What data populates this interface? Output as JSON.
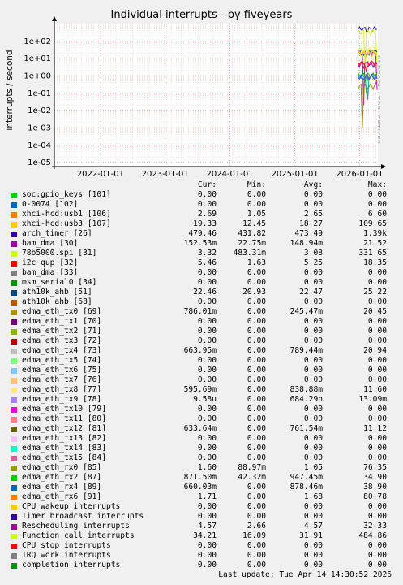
{
  "chart_data": {
    "type": "line",
    "title": "Individual interrupts - by fiveyears",
    "ylabel": "interrupts / second",
    "side_label": "RRDTOOL / TOBI OETIKER",
    "y_scale": "log",
    "y_ticks": [
      "1e-05",
      "1e-04",
      "1e-03",
      "1e-02",
      "1e-01",
      "1e+00",
      "1e+01",
      "1e+02"
    ],
    "x_ticks": [
      "2022-01-01",
      "2023-01-01",
      "2024-01-01",
      "2025-01-01",
      "2026-01-01"
    ],
    "grid": true,
    "data_start": "2025-12-25",
    "x_range": [
      "2021-04-16",
      "2026-04-14"
    ],
    "series": [
      {
        "name": "arch_timer [26]",
        "color": "#1b1bb4",
        "values": [
          431.82,
          479.46,
          473.49
        ]
      },
      {
        "name": "bam_dma [30]",
        "color": "#c800c8",
        "values": [
          0.02,
          0.15,
          21.52
        ]
      },
      {
        "name": "78b5000.spi [31]",
        "color": "#d8f022",
        "values": [
          3.32,
          3.08,
          331.65
        ]
      },
      {
        "name": "i2c_qup [32]",
        "color": "#f01b1b",
        "values": [
          1.63,
          5.46,
          5.25
        ]
      },
      {
        "name": "ath10k_ahb [51]",
        "color": "#0f5f6e",
        "values": [
          20.93,
          22.46,
          22.47
        ]
      },
      {
        "name": "edma_eth_tx0 [69]",
        "color": "#a08000",
        "values": [
          0.001,
          0.786,
          0.245
        ]
      },
      {
        "name": "edma_eth_tx4 [73]",
        "color": "#a0a0a0",
        "values": [
          0.6,
          0.66,
          0.79
        ]
      },
      {
        "name": "edma_eth_tx8 [77]",
        "color": "#fff080",
        "values": [
          0.6,
          0.6,
          0.84
        ]
      },
      {
        "name": "edma_eth_rx0 [85]",
        "color": "#33a02c",
        "values": [
          0.09,
          1.6,
          1.05
        ]
      },
      {
        "name": "edma_eth_rx2 [87]",
        "color": "#27a0a0",
        "values": [
          0.04,
          0.87,
          0.95
        ]
      },
      {
        "name": "edma_eth_rx4 [89]",
        "color": "#3060d0",
        "values": [
          0.66,
          0.66,
          0.88
        ]
      },
      {
        "name": "Rescheduling interrupts",
        "color": "#b000a0",
        "values": [
          2.66,
          4.57,
          4.57
        ]
      },
      {
        "name": "Function call interrupts",
        "color": "#f0f040",
        "values": [
          16.09,
          34.21,
          31.91
        ]
      },
      {
        "name": "xhci-hcd:usb3 [107]",
        "color": "#f0c000",
        "values": [
          12.45,
          19.33,
          18.27
        ]
      }
    ],
    "legend_columns": [
      "Cur:",
      "Min:",
      "Avg:",
      "Max:"
    ],
    "legend": [
      {
        "name": "soc:gpio_keys [101]",
        "color": "#00cc00",
        "cur": "0.00",
        "min": "0.00",
        "avg": "0.00",
        "max": "0.00"
      },
      {
        "name": "0-0074 [102]",
        "color": "#0066b3",
        "cur": "0.00",
        "min": "0.00",
        "avg": "0.00",
        "max": "0.00"
      },
      {
        "name": "xhci-hcd:usb1 [106]",
        "color": "#ff8000",
        "cur": "2.69",
        "min": "1.05",
        "avg": "2.65",
        "max": "6.60"
      },
      {
        "name": "xhci-hcd:usb3 [107]",
        "color": "#ffcc00",
        "cur": "19.33",
        "min": "12.45",
        "avg": "18.27",
        "max": "109.65"
      },
      {
        "name": "arch_timer [26]",
        "color": "#330099",
        "cur": "479.46",
        "min": "431.82",
        "avg": "473.49",
        "max": "1.39k"
      },
      {
        "name": "bam_dma [30]",
        "color": "#990099",
        "cur": "152.53m",
        "min": "22.75m",
        "avg": "148.94m",
        "max": "21.52"
      },
      {
        "name": "78b5000.spi [31]",
        "color": "#ccff00",
        "cur": "3.32",
        "min": "483.31m",
        "avg": "3.08",
        "max": "331.65"
      },
      {
        "name": "i2c_qup [32]",
        "color": "#ff0000",
        "cur": "5.46",
        "min": "1.63",
        "avg": "5.25",
        "max": "18.35"
      },
      {
        "name": "bam_dma [33]",
        "color": "#808080",
        "cur": "0.00",
        "min": "0.00",
        "avg": "0.00",
        "max": "0.00"
      },
      {
        "name": "msm_serial0 [34]",
        "color": "#008f00",
        "cur": "0.00",
        "min": "0.00",
        "avg": "0.00",
        "max": "0.00"
      },
      {
        "name": "ath10k_ahb [51]",
        "color": "#00487d",
        "cur": "22.46",
        "min": "20.93",
        "avg": "22.47",
        "max": "25.22"
      },
      {
        "name": "ath10k_ahb [68]",
        "color": "#b35a00",
        "cur": "0.00",
        "min": "0.00",
        "avg": "0.00",
        "max": "0.00"
      },
      {
        "name": "edma_eth_tx0 [69]",
        "color": "#b38f00",
        "cur": "786.01m",
        "min": "0.00",
        "avg": "245.47m",
        "max": "20.45"
      },
      {
        "name": "edma_eth_tx1 [70]",
        "color": "#6b006b",
        "cur": "0.00",
        "min": "0.00",
        "avg": "0.00",
        "max": "0.00"
      },
      {
        "name": "edma_eth_tx2 [71]",
        "color": "#8fb300",
        "cur": "0.00",
        "min": "0.00",
        "avg": "0.00",
        "max": "0.00"
      },
      {
        "name": "edma_eth_tx3 [72]",
        "color": "#b30000",
        "cur": "0.00",
        "min": "0.00",
        "avg": "0.00",
        "max": "0.00"
      },
      {
        "name": "edma_eth_tx4 [73]",
        "color": "#bebebe",
        "cur": "663.95m",
        "min": "0.00",
        "avg": "789.44m",
        "max": "20.94"
      },
      {
        "name": "edma_eth_tx5 [74]",
        "color": "#80ff80",
        "cur": "0.00",
        "min": "0.00",
        "avg": "0.00",
        "max": "0.00"
      },
      {
        "name": "edma_eth_tx6 [75]",
        "color": "#80c9ff",
        "cur": "0.00",
        "min": "0.00",
        "avg": "0.00",
        "max": "0.00"
      },
      {
        "name": "edma_eth_tx7 [76]",
        "color": "#ffc080",
        "cur": "0.00",
        "min": "0.00",
        "avg": "0.00",
        "max": "0.00"
      },
      {
        "name": "edma_eth_tx8 [77]",
        "color": "#ffe680",
        "cur": "595.69m",
        "min": "0.00",
        "avg": "838.88m",
        "max": "11.60"
      },
      {
        "name": "edma_eth_tx9 [78]",
        "color": "#aa80ff",
        "cur": "9.58u",
        "min": "0.00",
        "avg": "684.29n",
        "max": "13.09m"
      },
      {
        "name": "edma_eth_tx10 [79]",
        "color": "#ee00cc",
        "cur": "0.00",
        "min": "0.00",
        "avg": "0.00",
        "max": "0.00"
      },
      {
        "name": "edma_eth_tx11 [80]",
        "color": "#ff8080",
        "cur": "0.00",
        "min": "0.00",
        "avg": "0.00",
        "max": "0.00"
      },
      {
        "name": "edma_eth_tx12 [81]",
        "color": "#666600",
        "cur": "633.64m",
        "min": "0.00",
        "avg": "761.54m",
        "max": "11.12"
      },
      {
        "name": "edma_eth_tx13 [82]",
        "color": "#ffbfff",
        "cur": "0.00",
        "min": "0.00",
        "avg": "0.00",
        "max": "0.00"
      },
      {
        "name": "edma_eth_tx14 [83]",
        "color": "#00ffcc",
        "cur": "0.00",
        "min": "0.00",
        "avg": "0.00",
        "max": "0.00"
      },
      {
        "name": "edma_eth_tx15 [84]",
        "color": "#cc6699",
        "cur": "0.00",
        "min": "0.00",
        "avg": "0.00",
        "max": "0.00"
      },
      {
        "name": "edma_eth_rx0 [85]",
        "color": "#999900",
        "cur": "1.60",
        "min": "88.97m",
        "avg": "1.05",
        "max": "76.35"
      },
      {
        "name": "edma_eth_rx2 [87]",
        "color": "#00cc00",
        "cur": "871.50m",
        "min": "42.32m",
        "avg": "947.45m",
        "max": "34.90"
      },
      {
        "name": "edma_eth_rx4 [89]",
        "color": "#0066b3",
        "cur": "660.03m",
        "min": "0.00",
        "avg": "878.46m",
        "max": "38.90"
      },
      {
        "name": "edma_eth_rx6 [91]",
        "color": "#ff8000",
        "cur": "1.71",
        "min": "0.00",
        "avg": "1.68",
        "max": "80.78"
      },
      {
        "name": "CPU wakeup interrupts",
        "color": "#ffcc00",
        "cur": "0.00",
        "min": "0.00",
        "avg": "0.00",
        "max": "0.00"
      },
      {
        "name": "Timer broadcast interrupts",
        "color": "#330099",
        "cur": "0.00",
        "min": "0.00",
        "avg": "0.00",
        "max": "0.00"
      },
      {
        "name": "Rescheduling interrupts",
        "color": "#990099",
        "cur": "4.57",
        "min": "2.66",
        "avg": "4.57",
        "max": "32.33"
      },
      {
        "name": "Function call interrupts",
        "color": "#ccff00",
        "cur": "34.21",
        "min": "16.09",
        "avg": "31.91",
        "max": "484.86"
      },
      {
        "name": "CPU stop interrupts",
        "color": "#ff0000",
        "cur": "0.00",
        "min": "0.00",
        "avg": "0.00",
        "max": "0.00"
      },
      {
        "name": "IRQ work interrupts",
        "color": "#808080",
        "cur": "0.00",
        "min": "0.00",
        "avg": "0.00",
        "max": "0.00"
      },
      {
        "name": "completion interrupts",
        "color": "#008f00",
        "cur": "0.00",
        "min": "0.00",
        "avg": "0.00",
        "max": "0.00"
      }
    ]
  },
  "footer": "Last update: Tue Apr 14 14:30:52 2026"
}
